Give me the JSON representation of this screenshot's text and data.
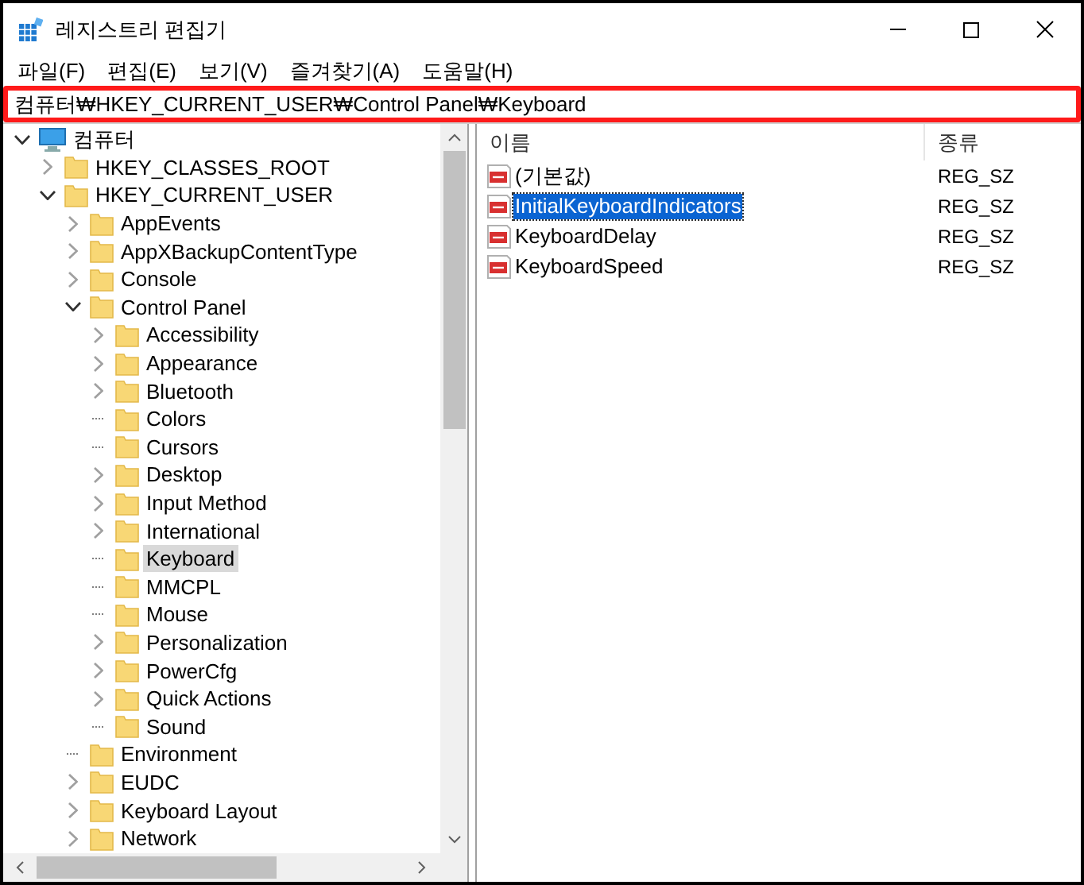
{
  "window": {
    "title": "레지스트리 편집기"
  },
  "menu": [
    "파일(F)",
    "편집(E)",
    "보기(V)",
    "즐겨찾기(A)",
    "도움말(H)"
  ],
  "address": {
    "value": "컴퓨터₩HKEY_CURRENT_USER₩Control Panel₩Keyboard",
    "highlighted": true
  },
  "tree": [
    {
      "label": "컴퓨터",
      "expanded": true,
      "selected": false,
      "children": [
        {
          "label": "HKEY_CLASSES_ROOT",
          "expanded": false,
          "selected": false
        },
        {
          "label": "HKEY_CURRENT_USER",
          "expanded": true,
          "selected": false,
          "children": [
            {
              "label": "AppEvents",
              "expanded": false,
              "selected": false
            },
            {
              "label": "AppXBackupContentType",
              "expanded": false,
              "selected": false
            },
            {
              "label": "Console",
              "expanded": false,
              "selected": false
            },
            {
              "label": "Control Panel",
              "expanded": true,
              "selected": false,
              "children": [
                {
                  "label": "Accessibility",
                  "expanded": false,
                  "selected": false
                },
                {
                  "label": "Appearance",
                  "expanded": false,
                  "selected": false
                },
                {
                  "label": "Bluetooth",
                  "expanded": false,
                  "selected": false
                },
                {
                  "label": "Colors",
                  "selected": false
                },
                {
                  "label": "Cursors",
                  "selected": false
                },
                {
                  "label": "Desktop",
                  "expanded": false,
                  "selected": false
                },
                {
                  "label": "Input Method",
                  "expanded": false,
                  "selected": false
                },
                {
                  "label": "International",
                  "expanded": false,
                  "selected": false
                },
                {
                  "label": "Keyboard",
                  "selected": true
                },
                {
                  "label": "MMCPL",
                  "selected": false
                },
                {
                  "label": "Mouse",
                  "selected": false
                },
                {
                  "label": "Personalization",
                  "expanded": false,
                  "selected": false
                },
                {
                  "label": "PowerCfg",
                  "expanded": false,
                  "selected": false
                },
                {
                  "label": "Quick Actions",
                  "expanded": false,
                  "selected": false
                },
                {
                  "label": "Sound",
                  "selected": false
                }
              ]
            },
            {
              "label": "Environment",
              "selected": false
            },
            {
              "label": "EUDC",
              "expanded": false,
              "selected": false
            },
            {
              "label": "Keyboard Layout",
              "expanded": false,
              "selected": false
            },
            {
              "label": "Network",
              "expanded": false,
              "selected": false
            }
          ]
        }
      ]
    }
  ],
  "values": {
    "columns": [
      "이름",
      "종류"
    ],
    "rows": [
      {
        "name": "(기본값)",
        "type": "REG_SZ",
        "selected": false
      },
      {
        "name": "InitialKeyboardIndicators",
        "type": "REG_SZ",
        "selected": true
      },
      {
        "name": "KeyboardDelay",
        "type": "REG_SZ",
        "selected": false
      },
      {
        "name": "KeyboardSpeed",
        "type": "REG_SZ",
        "selected": false
      }
    ]
  }
}
